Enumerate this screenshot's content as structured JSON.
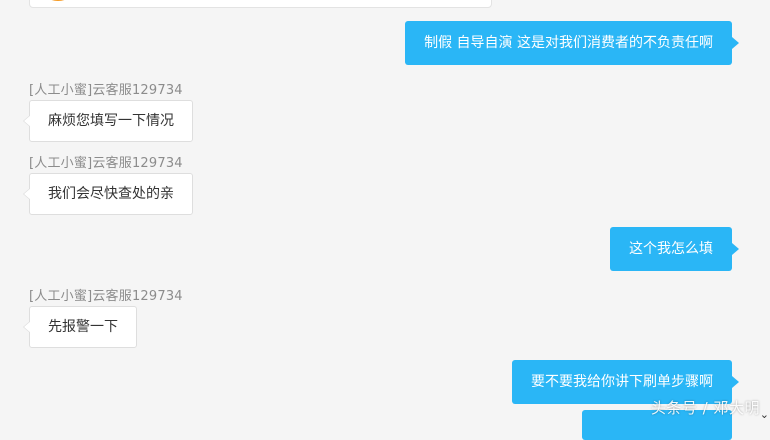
{
  "messages": [
    {
      "side": "out",
      "text": "制假 自导自演 这是对我们消费者的不负责任啊"
    },
    {
      "side": "in",
      "sender": "[人工小蜜]云客服129734",
      "text": "麻烦您填写一下情况"
    },
    {
      "side": "in",
      "sender": "[人工小蜜]云客服129734",
      "text": "我们会尽快查处的亲"
    },
    {
      "side": "out",
      "text": "这个我怎么填"
    },
    {
      "side": "in",
      "sender": "[人工小蜜]云客服129734",
      "text": "先报警一下"
    },
    {
      "side": "out",
      "text": "要不要我给你讲下刷单步骤啊"
    }
  ],
  "watermark": "头条号 / 邓大明",
  "icons": {
    "scroll_down": "chevron-down-icon",
    "avatar": "agent-avatar-icon"
  },
  "colors": {
    "outgoing_bubble": "#2ab6f6",
    "incoming_bubble": "#ffffff",
    "background": "#f5f5f5",
    "sender_text": "#8c8c8c"
  }
}
